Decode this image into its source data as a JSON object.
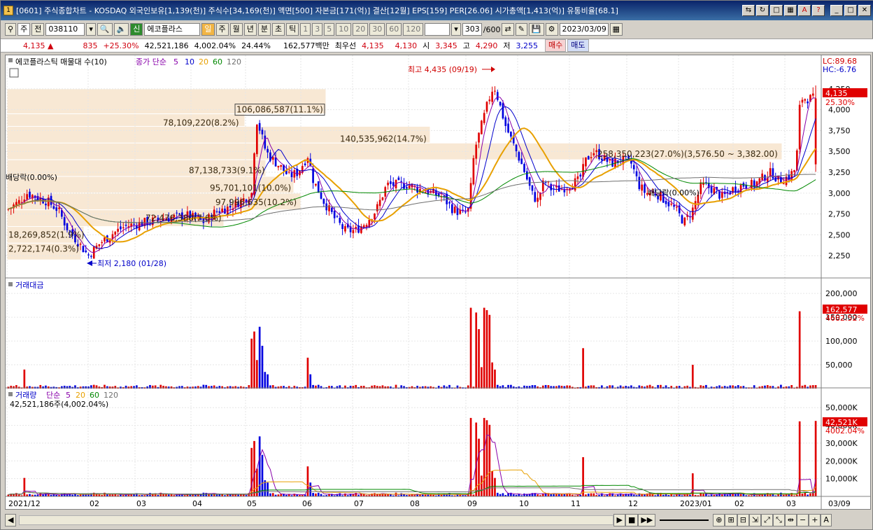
{
  "window": {
    "title": "[0601] 주식종합차트 - KOSDAQ 외국인보유[1,139(천)] 주식수[34,169(천)] 액면[500] 자본금[171(억)] 결산[12월] EPS[159] PER[26.06] 시가총액[1,413(억)] 유통비율[68.1]",
    "icon_label": "1"
  },
  "toolbar": {
    "period_type": "주",
    "prev_label": "전",
    "code": "038110",
    "new_badge": "신",
    "stock_name": "에코플라스",
    "periods": [
      "일",
      "주",
      "월",
      "년",
      "분",
      "초",
      "틱"
    ],
    "active_period": "일",
    "intervals": [
      "1",
      "3",
      "5",
      "10",
      "20",
      "30",
      "60",
      "120"
    ],
    "count": "303",
    "count_total": "/600",
    "date": "2023/03/09"
  },
  "info": {
    "price": "4,135",
    "change_arrow": "▲",
    "change": "835",
    "change_pct": "+25.30%",
    "volume": "42,521,186",
    "volume_ratio": "4,002.04%",
    "turnover": "24.44%",
    "trade_value": "162,577백만",
    "best_label": "최우선",
    "best_ask": "4,135",
    "best_bid": "4,130",
    "open_label": "시",
    "open": "3,345",
    "high_label": "고",
    "high": "4,290",
    "low_label": "저",
    "low": "3,255",
    "buy_label": "매수",
    "sell_label": "매도"
  },
  "colors": {
    "up": "#e00000",
    "down": "#0000e0",
    "ma5": "#8800aa",
    "ma10": "#0000cc",
    "ma20": "#e8a000",
    "ma60": "#008800",
    "ma120": "#707070",
    "band": "#f8e8d4"
  },
  "price_panel": {
    "title": "에코플라스틱 매물대 수(10)",
    "ma_title": "종가 단순",
    "ma_periods": [
      "5",
      "10",
      "20",
      "60",
      "120"
    ],
    "lc": "LC:89.68",
    "hc": "HC:-6.76",
    "current_price": "4,135",
    "current_pct": "25.30%",
    "high_note": "최고 4,435 (09/19)",
    "low_note": "최저 2,180 (01/28)",
    "dividend_notes": [
      "배당락(0.00%)",
      "배당락(0.00%)"
    ],
    "volume_profile": [
      {
        "label": "106,086,587(11.1%)"
      },
      {
        "label": "78,109,220(8.2%)"
      },
      {
        "label": "140,535,962(14.7%)"
      },
      {
        "label": "258,350,223(27.0%)(3,576.50 ~ 3,382.00)"
      },
      {
        "label": "87,138,733(9.1%)"
      },
      {
        "label": "95,701,101(10.0%)"
      },
      {
        "label": "97,996,635(10.2%)"
      },
      {
        "label": "72,476,380(7.6%)"
      },
      {
        "label": "18,269,852(1.9%)"
      },
      {
        "label": "2,722,174(0.3%)"
      }
    ],
    "y_ticks": [
      "4,250",
      "4,000",
      "3,750",
      "3,500",
      "3,250",
      "3,000",
      "2,750",
      "2,500",
      "2,250"
    ]
  },
  "value_panel": {
    "title": "거래대금",
    "current": "162,577",
    "current_pct": "4682.52%",
    "y_ticks": [
      "200,000",
      "150,000",
      "100,000",
      "50,000"
    ]
  },
  "volume_panel": {
    "title": "거래량",
    "ma_title": "단순",
    "ma_periods": [
      "5",
      "20",
      "60",
      "120"
    ],
    "subtitle": "42,521,186주(4,002.04%)",
    "current": "42,521K",
    "current_pct": "4002.04%",
    "y_ticks": [
      "50,000K",
      "40,000K",
      "30,000K",
      "20,000K",
      "10,000K"
    ]
  },
  "x_axis": {
    "labels": [
      "2021/12",
      "02",
      "03",
      "04",
      "05",
      "06",
      "07",
      "08",
      "09",
      "10",
      "11",
      "12",
      "2023/01",
      "02",
      "03"
    ],
    "end_label": "03/09"
  },
  "chart_data": {
    "type": "candlestick",
    "price_range": [
      2000,
      4450
    ],
    "months": [
      "2021/12",
      "2022/01",
      "2022/02",
      "2022/03",
      "2022/04",
      "2022/05",
      "2022/06",
      "2022/07",
      "2022/08",
      "2022/09",
      "2022/10",
      "2022/11",
      "2022/12",
      "2023/01",
      "2023/02",
      "2023/03"
    ],
    "key_points": [
      {
        "label": "최고",
        "date": "09/19",
        "value": 4435
      },
      {
        "label": "최저",
        "date": "01/28",
        "value": 2180
      },
      {
        "label": "current",
        "date": "03/09",
        "value": 4135
      }
    ],
    "last_candle": {
      "open": 3345,
      "high": 4290,
      "low": 3255,
      "close": 4135
    },
    "trade_value_max": 200000,
    "volume_max_k": 55000
  }
}
